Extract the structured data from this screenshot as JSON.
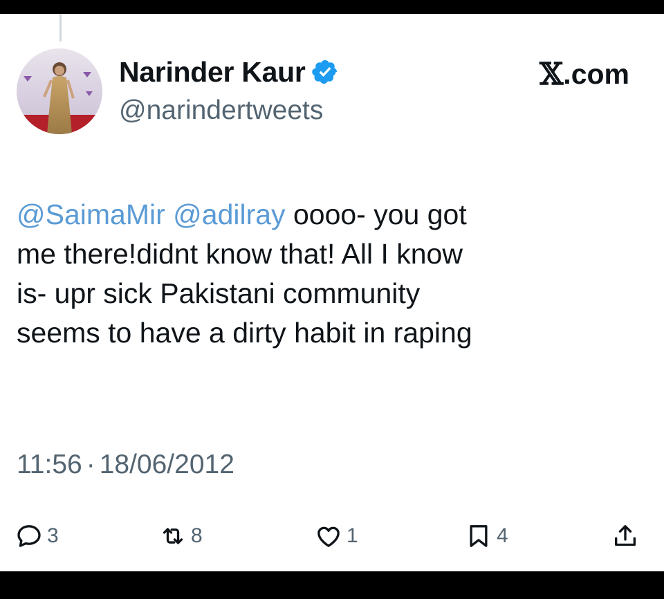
{
  "tweet": {
    "author": {
      "display_name": "Narinder Kaur",
      "handle": "@narindertweets",
      "verified": true
    },
    "brand": {
      "x_glyph": "𝕏",
      "domain": ".com"
    },
    "text": {
      "mention_1": "@SaimaMir",
      "mention_2": "@adilray",
      "line_1_rest": "oooo- you got",
      "line_2": "me there!didnt know that! All I know",
      "line_3": "is- upr sick Pakistani community",
      "line_4": "seems to have a dirty habit in raping"
    },
    "timestamp": {
      "time": "11:56",
      "separator": "·",
      "date": "18/06/2012"
    },
    "actions": {
      "replies": "3",
      "retweets": "8",
      "likes": "1",
      "bookmarks": "4"
    }
  },
  "colors": {
    "mention": "#5b9bd5",
    "verified": "#1d9bf0",
    "muted": "#536471",
    "text": "#0f1419"
  },
  "icons": {
    "reply": "speech-bubble-icon",
    "retweet": "retweet-arrows-icon",
    "like": "heart-icon",
    "bookmark": "bookmark-icon",
    "share": "share-upload-icon",
    "verified": "verified-badge-icon"
  }
}
